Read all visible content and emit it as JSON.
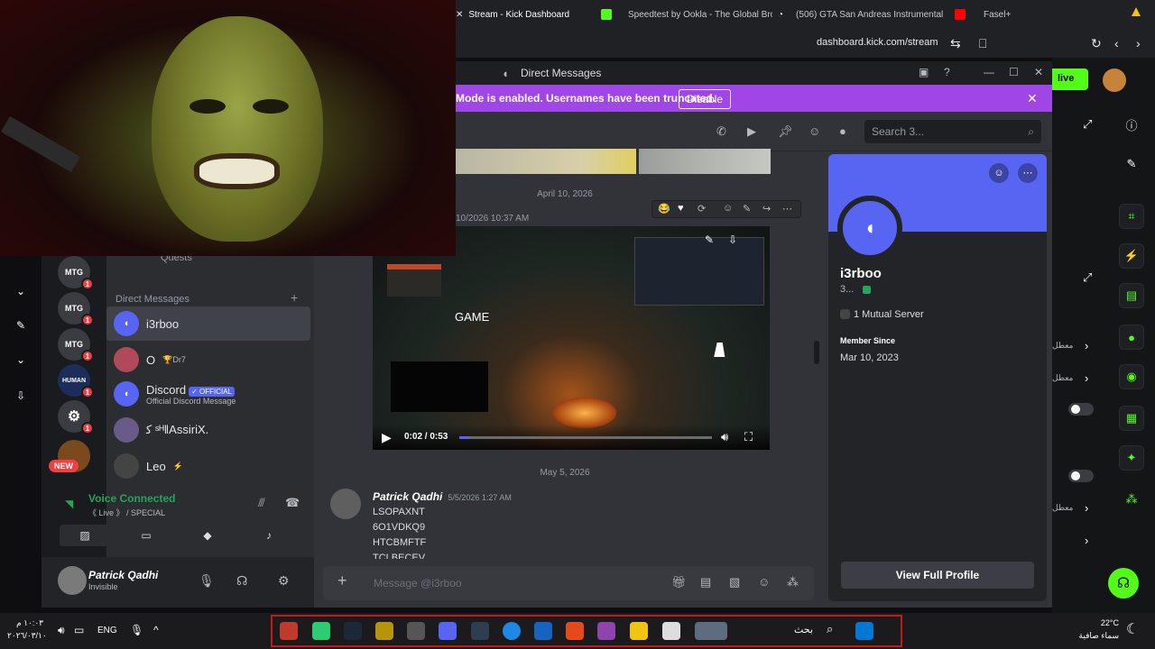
{
  "browser": {
    "tabs": [
      {
        "label": "Stream - Kick Dashboard",
        "color": "#53fc18"
      },
      {
        "label": "Speedtest by Ookla - The Global Broa",
        "color": "#ffffff"
      },
      {
        "label": "(506) GTA San Andreas Instrumental",
        "color": "#ff0000"
      },
      {
        "label": "Fasel+",
        "color": "#f4c20d"
      }
    ],
    "url": "dashboard.kick.com/stream"
  },
  "kick": {
    "live_label": "live",
    "ar_labels": [
      "معطل",
      "معطل",
      "معطل"
    ]
  },
  "discord": {
    "window_title": "Direct Messages",
    "streamer_mode_text": "Mode is enabled. Usernames have been truncated.",
    "disable_label": "Disable",
    "search_placeholder": "Search 3...",
    "servers": [
      {
        "label": "MTG",
        "badge": "1"
      },
      {
        "label": "MTG",
        "badge": "1"
      },
      {
        "label": "MTG",
        "badge": "1"
      },
      {
        "label": "HUMAN",
        "badge": "1"
      },
      {
        "label": "⚙",
        "badge": "1"
      },
      {
        "label": "",
        "badge": ""
      }
    ],
    "new_label": "NEW",
    "quests_label": "Quests",
    "dm_header": "Direct Messages",
    "dms": [
      {
        "name": "i3rboo",
        "sub": ""
      },
      {
        "name": "O",
        "sub": "🏆Dr7"
      },
      {
        "name": "Discord",
        "sub": "Official Discord Message",
        "tag": "✓ OFFICIAL"
      },
      {
        "name": "ﮐ ˢᴴ‖AssiriX.",
        "sub": ""
      },
      {
        "name": "Leo",
        "sub": "⚡"
      }
    ],
    "voice": {
      "status": "Voice Connected",
      "channel": "《 Live 》 / SPECIAL"
    },
    "user": {
      "name": "Patrick Qadhi",
      "status": "Invisible"
    },
    "chat": {
      "date1": "April 10, 2026",
      "msg1_time": "10/2026 10:37 AM",
      "video_game_label": "GAME",
      "video_time": "0:02 / 0:53",
      "video_progress": 0.04,
      "date2": "May 5, 2026",
      "msg2_author": "Patrick Qadhi",
      "msg2_time": "5/5/2026 1:27 AM",
      "msg2_lines": [
        "LSOPAXNT",
        "6O1VDKQ9",
        "HTCBMFTF",
        "TCLBECEV"
      ],
      "composer_placeholder": "Message @i3rboo"
    },
    "profile": {
      "name": "i3rboo",
      "tag": "3...",
      "mutual": "1 Mutual Server",
      "member_since_label": "Member Since",
      "member_since": "Mar 10, 2023",
      "view_full_label": "View Full Profile"
    }
  },
  "taskbar": {
    "time": "١٠:٠٣ م",
    "date": "٢٠٢٦/٠٣/١٠",
    "lang": "ENG",
    "weather_temp": "22°C",
    "weather_desc": "سماء صافية",
    "search_label": "بحث"
  }
}
